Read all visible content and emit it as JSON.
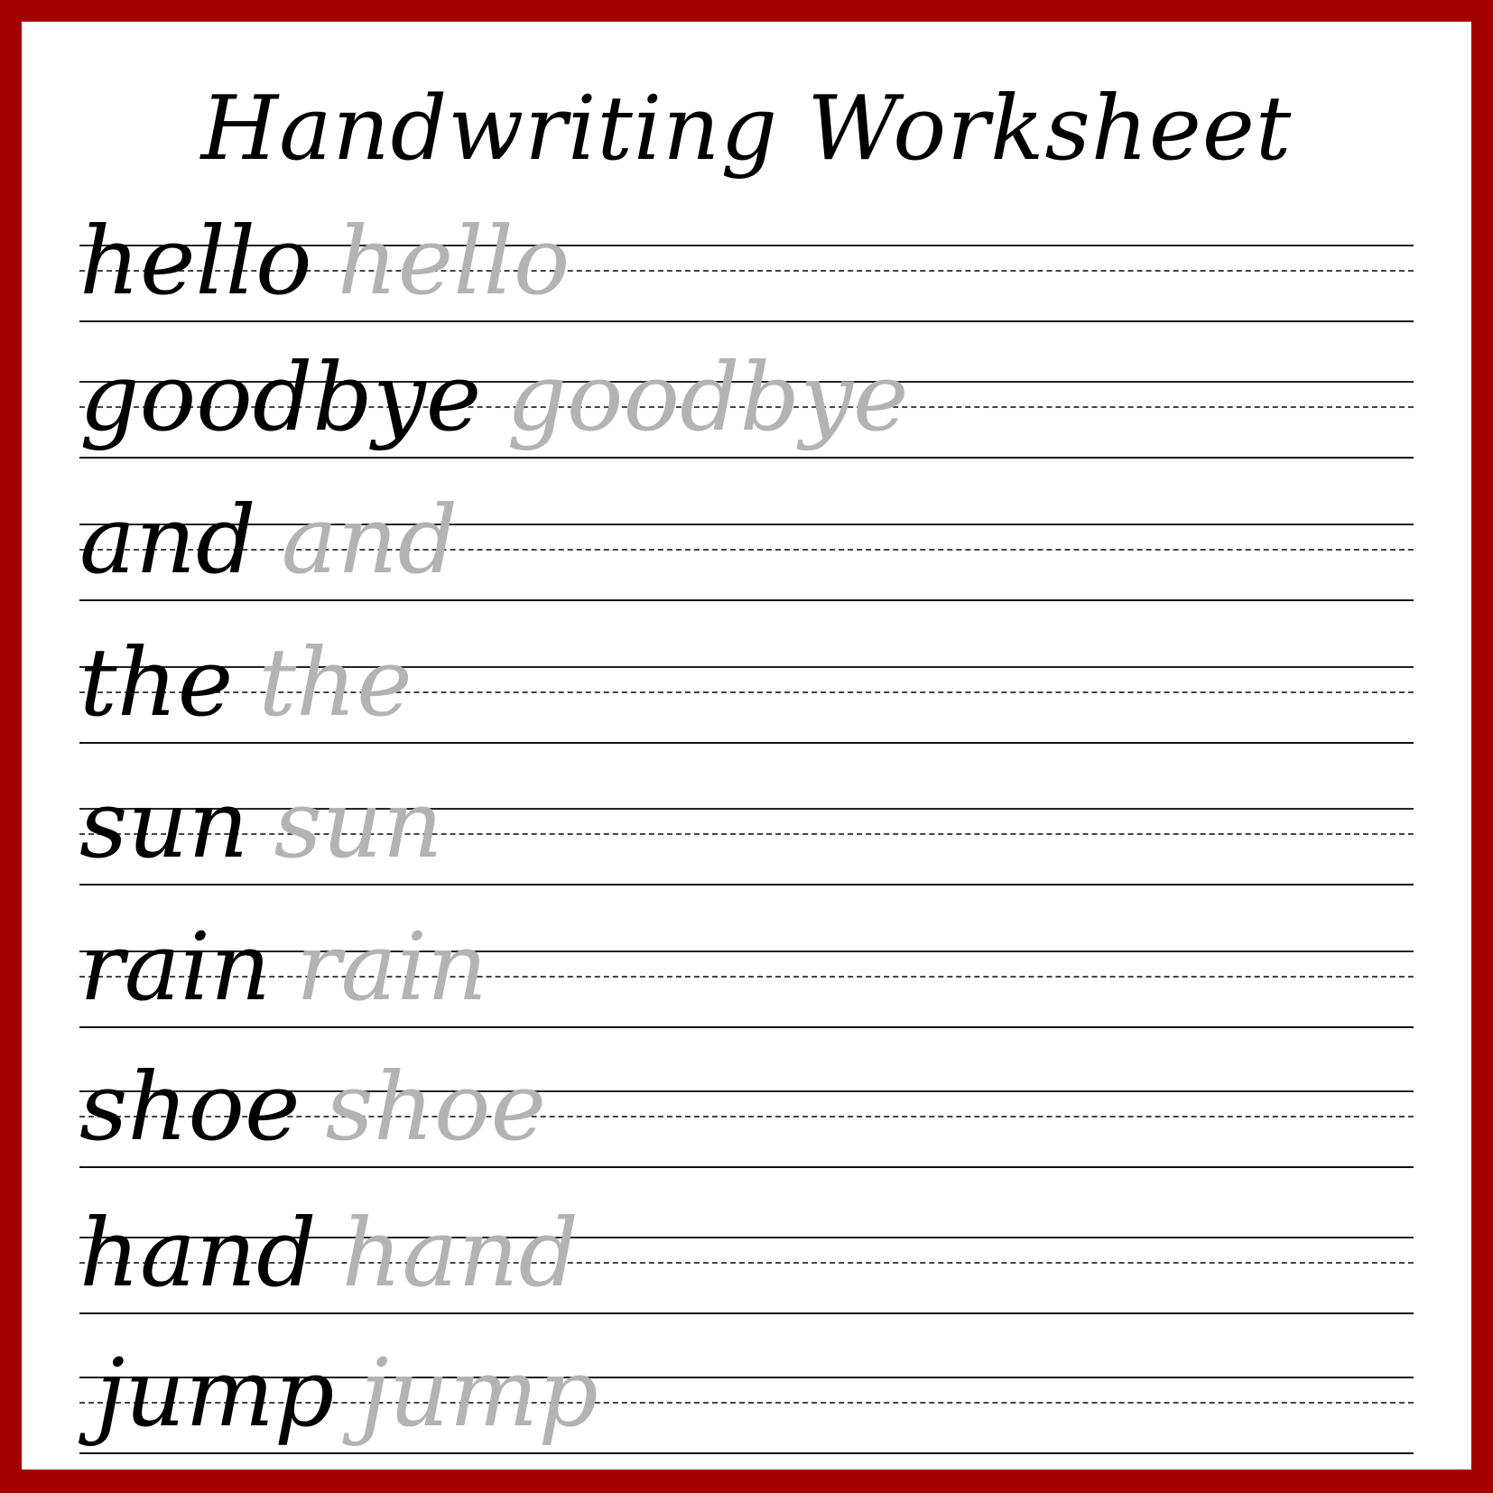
{
  "title": "Handwriting Worksheet",
  "colors": {
    "border": "#a30000",
    "model_text": "#000000",
    "trace_text": "#b3b3b3"
  },
  "rows": [
    {
      "word": "hello",
      "trace": "hello"
    },
    {
      "word": "goodbye",
      "trace": "goodbye"
    },
    {
      "word": "and",
      "trace": "and"
    },
    {
      "word": "the",
      "trace": "the"
    },
    {
      "word": "sun",
      "trace": "sun"
    },
    {
      "word": "rain",
      "trace": "rain"
    },
    {
      "word": "shoe",
      "trace": "shoe"
    },
    {
      "word": "hand",
      "trace": "hand"
    },
    {
      "word": "jump",
      "trace": "jump"
    }
  ]
}
